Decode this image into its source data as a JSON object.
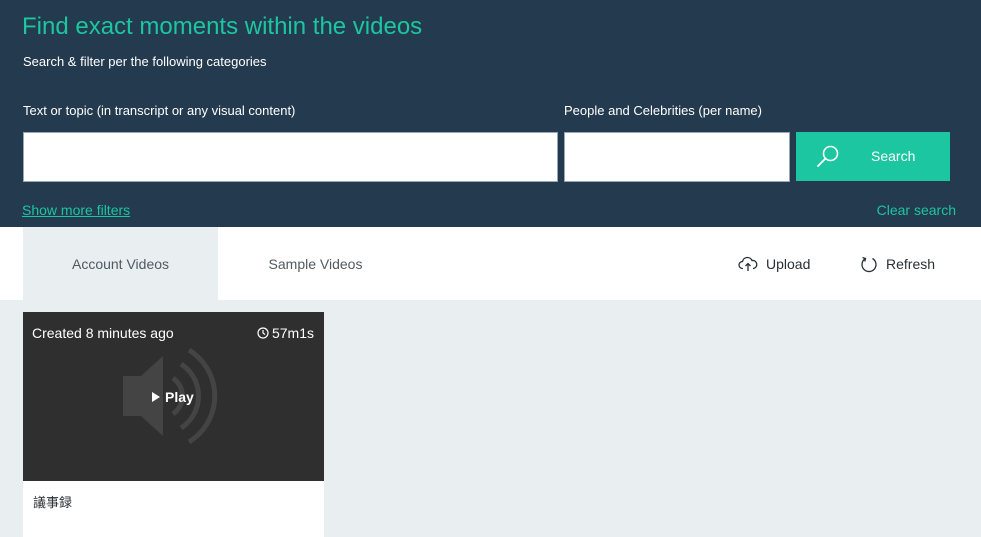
{
  "header": {
    "title": "Find exact moments within the videos",
    "subtitle": "Search & filter per the following categories",
    "text_label": "Text or topic (in transcript or any visual content)",
    "text_value": "",
    "text_placeholder": "",
    "people_label": "People and Celebrities (per name)",
    "people_value": "",
    "people_placeholder": "",
    "search_label": "Search",
    "more_filters": "Show more filters",
    "clear_search": "Clear search"
  },
  "tabs": [
    {
      "label": "Account Videos",
      "active": true
    },
    {
      "label": "Sample Videos",
      "active": false
    }
  ],
  "actions": {
    "upload": "Upload",
    "refresh": "Refresh"
  },
  "videos": [
    {
      "created": "Created 8 minutes ago",
      "duration": "57m1s",
      "play": "Play",
      "name": "議事録"
    }
  ],
  "colors": {
    "header_bg": "#243a4e",
    "accent": "#1bc6a0",
    "page_bg": "#e9eef0",
    "thumb_bg": "#2f2f2f"
  }
}
